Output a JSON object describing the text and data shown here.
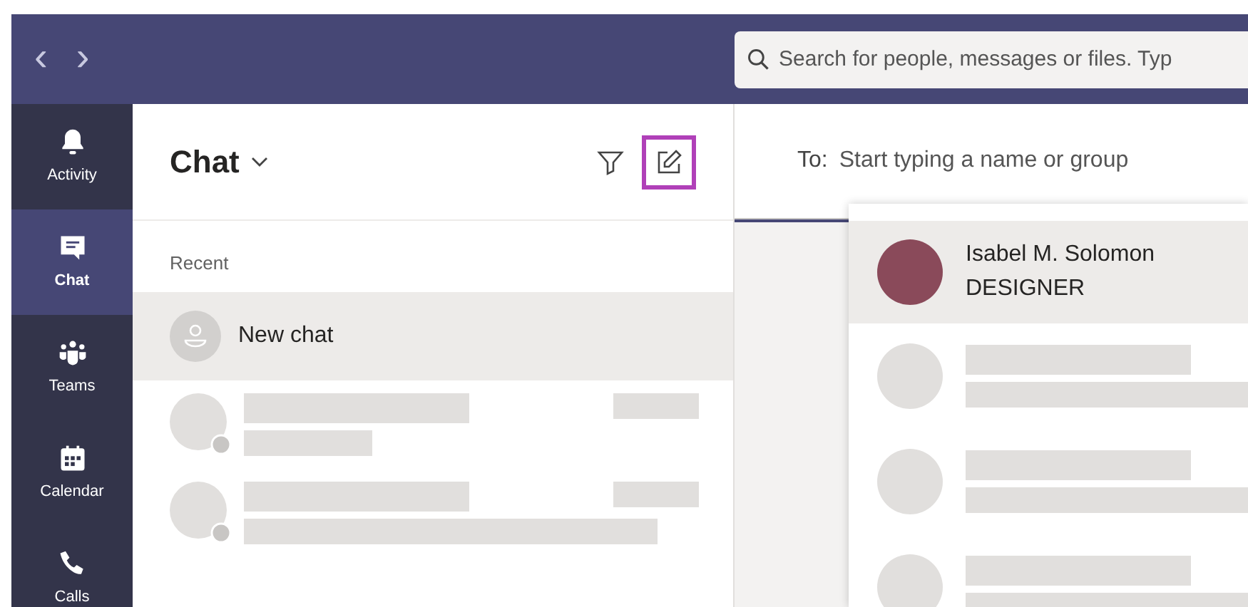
{
  "title_bar": {
    "back": "‹",
    "forward": "›",
    "search": {
      "placeholder": "Search for people, messages or files. Typ"
    }
  },
  "rail": [
    {
      "kind": "activity",
      "label": "Activity",
      "selected": false
    },
    {
      "kind": "chat",
      "label": "Chat",
      "selected": true
    },
    {
      "kind": "teams",
      "label": "Teams",
      "selected": false
    },
    {
      "kind": "calendar",
      "label": "Calendar",
      "selected": false
    },
    {
      "kind": "calls",
      "label": "Calls",
      "selected": false
    }
  ],
  "chat_list": {
    "title": "Chat",
    "compose_highlighted": true,
    "section": "Recent",
    "items": [
      {
        "label": "New chat",
        "selected": true
      }
    ]
  },
  "compose": {
    "to_label": "To:",
    "placeholder": "Start typing a name or group",
    "suggestions": [
      {
        "name": "Isabel M. Solomon",
        "role": "DESIGNER",
        "selected": true
      }
    ]
  }
}
